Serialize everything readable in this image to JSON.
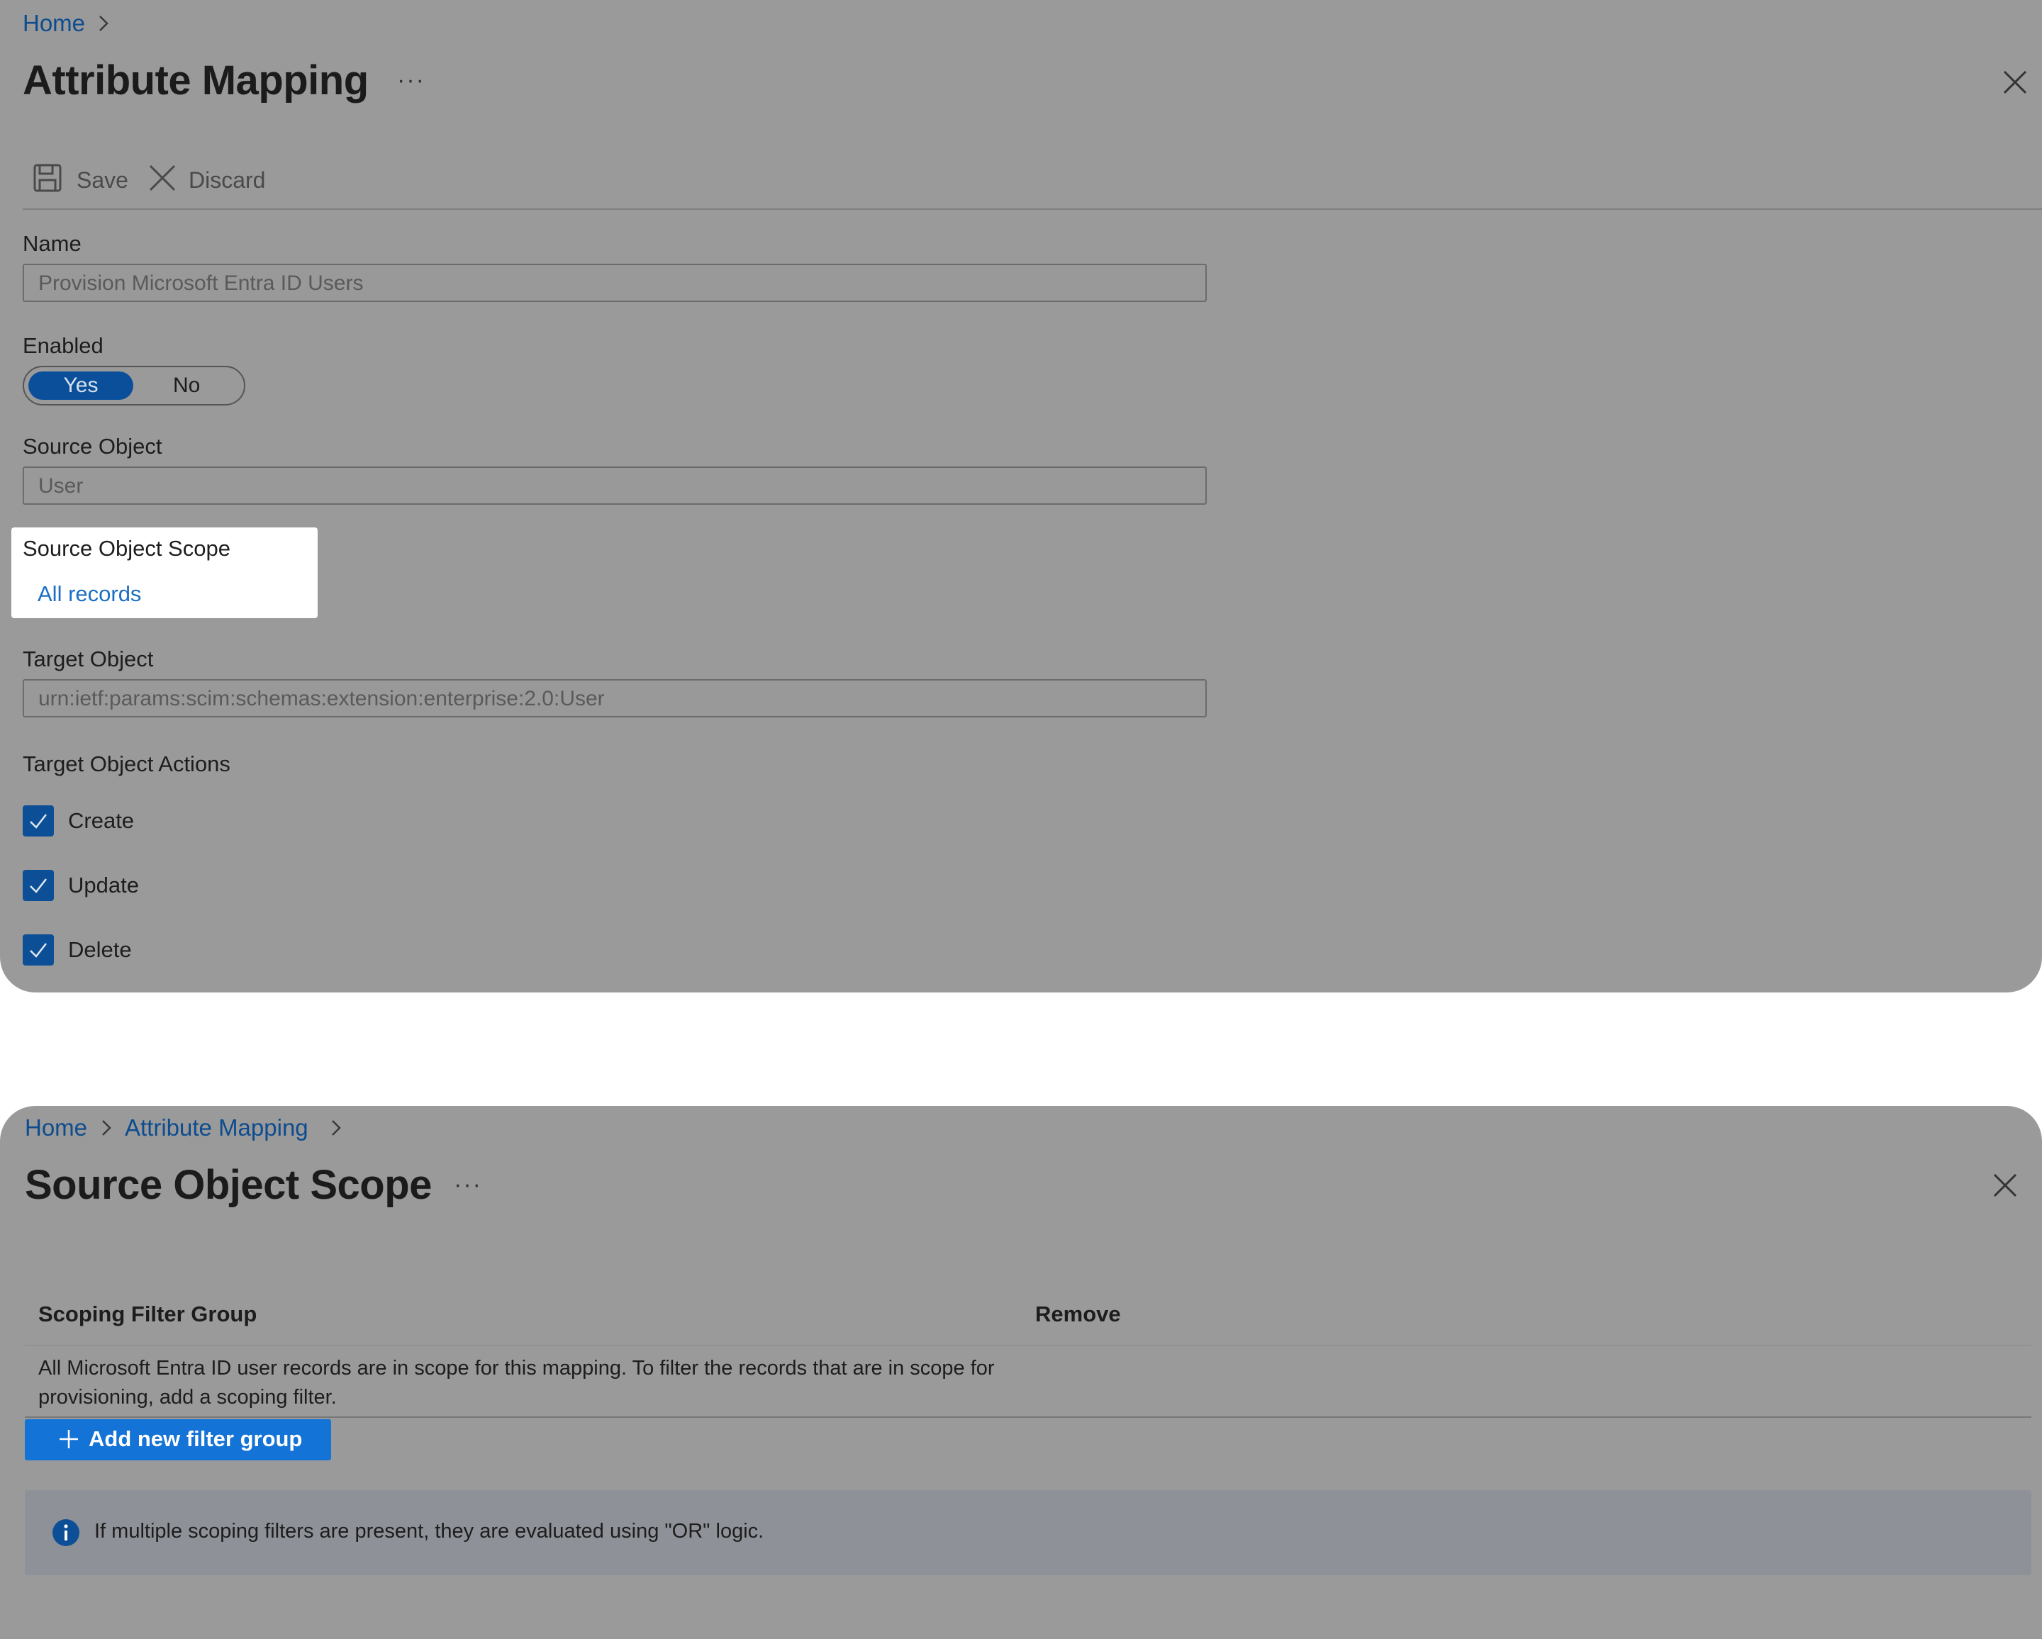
{
  "panel1": {
    "breadcrumb": [
      {
        "label": "Home"
      }
    ],
    "title": "Attribute Mapping",
    "more_label": "···",
    "toolbar": {
      "save_label": "Save",
      "discard_label": "Discard"
    },
    "name": {
      "label": "Name",
      "value": "Provision Microsoft Entra ID Users"
    },
    "enabled": {
      "label": "Enabled",
      "options": [
        "Yes",
        "No"
      ],
      "selected": "Yes"
    },
    "source_object": {
      "label": "Source Object",
      "value": "User"
    },
    "source_object_scope": {
      "label": "Source Object Scope",
      "link": "All records"
    },
    "target_object": {
      "label": "Target Object",
      "value": "urn:ietf:params:scim:schemas:extension:enterprise:2.0:User"
    },
    "target_actions": {
      "label": "Target Object Actions",
      "items": [
        {
          "label": "Create",
          "checked": true
        },
        {
          "label": "Update",
          "checked": true
        },
        {
          "label": "Delete",
          "checked": true
        }
      ]
    }
  },
  "panel2": {
    "breadcrumb": [
      {
        "label": "Home"
      },
      {
        "label": "Attribute Mapping"
      }
    ],
    "title": "Source Object Scope",
    "more_label": "···",
    "table": {
      "headers": [
        "Scoping Filter Group",
        "Remove"
      ],
      "empty_message": "All Microsoft Entra ID user records are in scope for this mapping. To filter the records that are in scope for provisioning, add a scoping filter."
    },
    "add_button_label": "Add new filter group",
    "info_text": "If multiple scoping filters are present, they are evaluated using \"OR\" logic."
  },
  "colors": {
    "accent": "#0b4f9b",
    "button": "#1373d6",
    "link": "#1a6fc2",
    "overlay": "#9a9a9a"
  },
  "icons": [
    "chevron-right-icon",
    "more-icon",
    "close-icon",
    "save-icon",
    "discard-icon",
    "checkmark-icon",
    "plus-icon",
    "info-icon"
  ]
}
